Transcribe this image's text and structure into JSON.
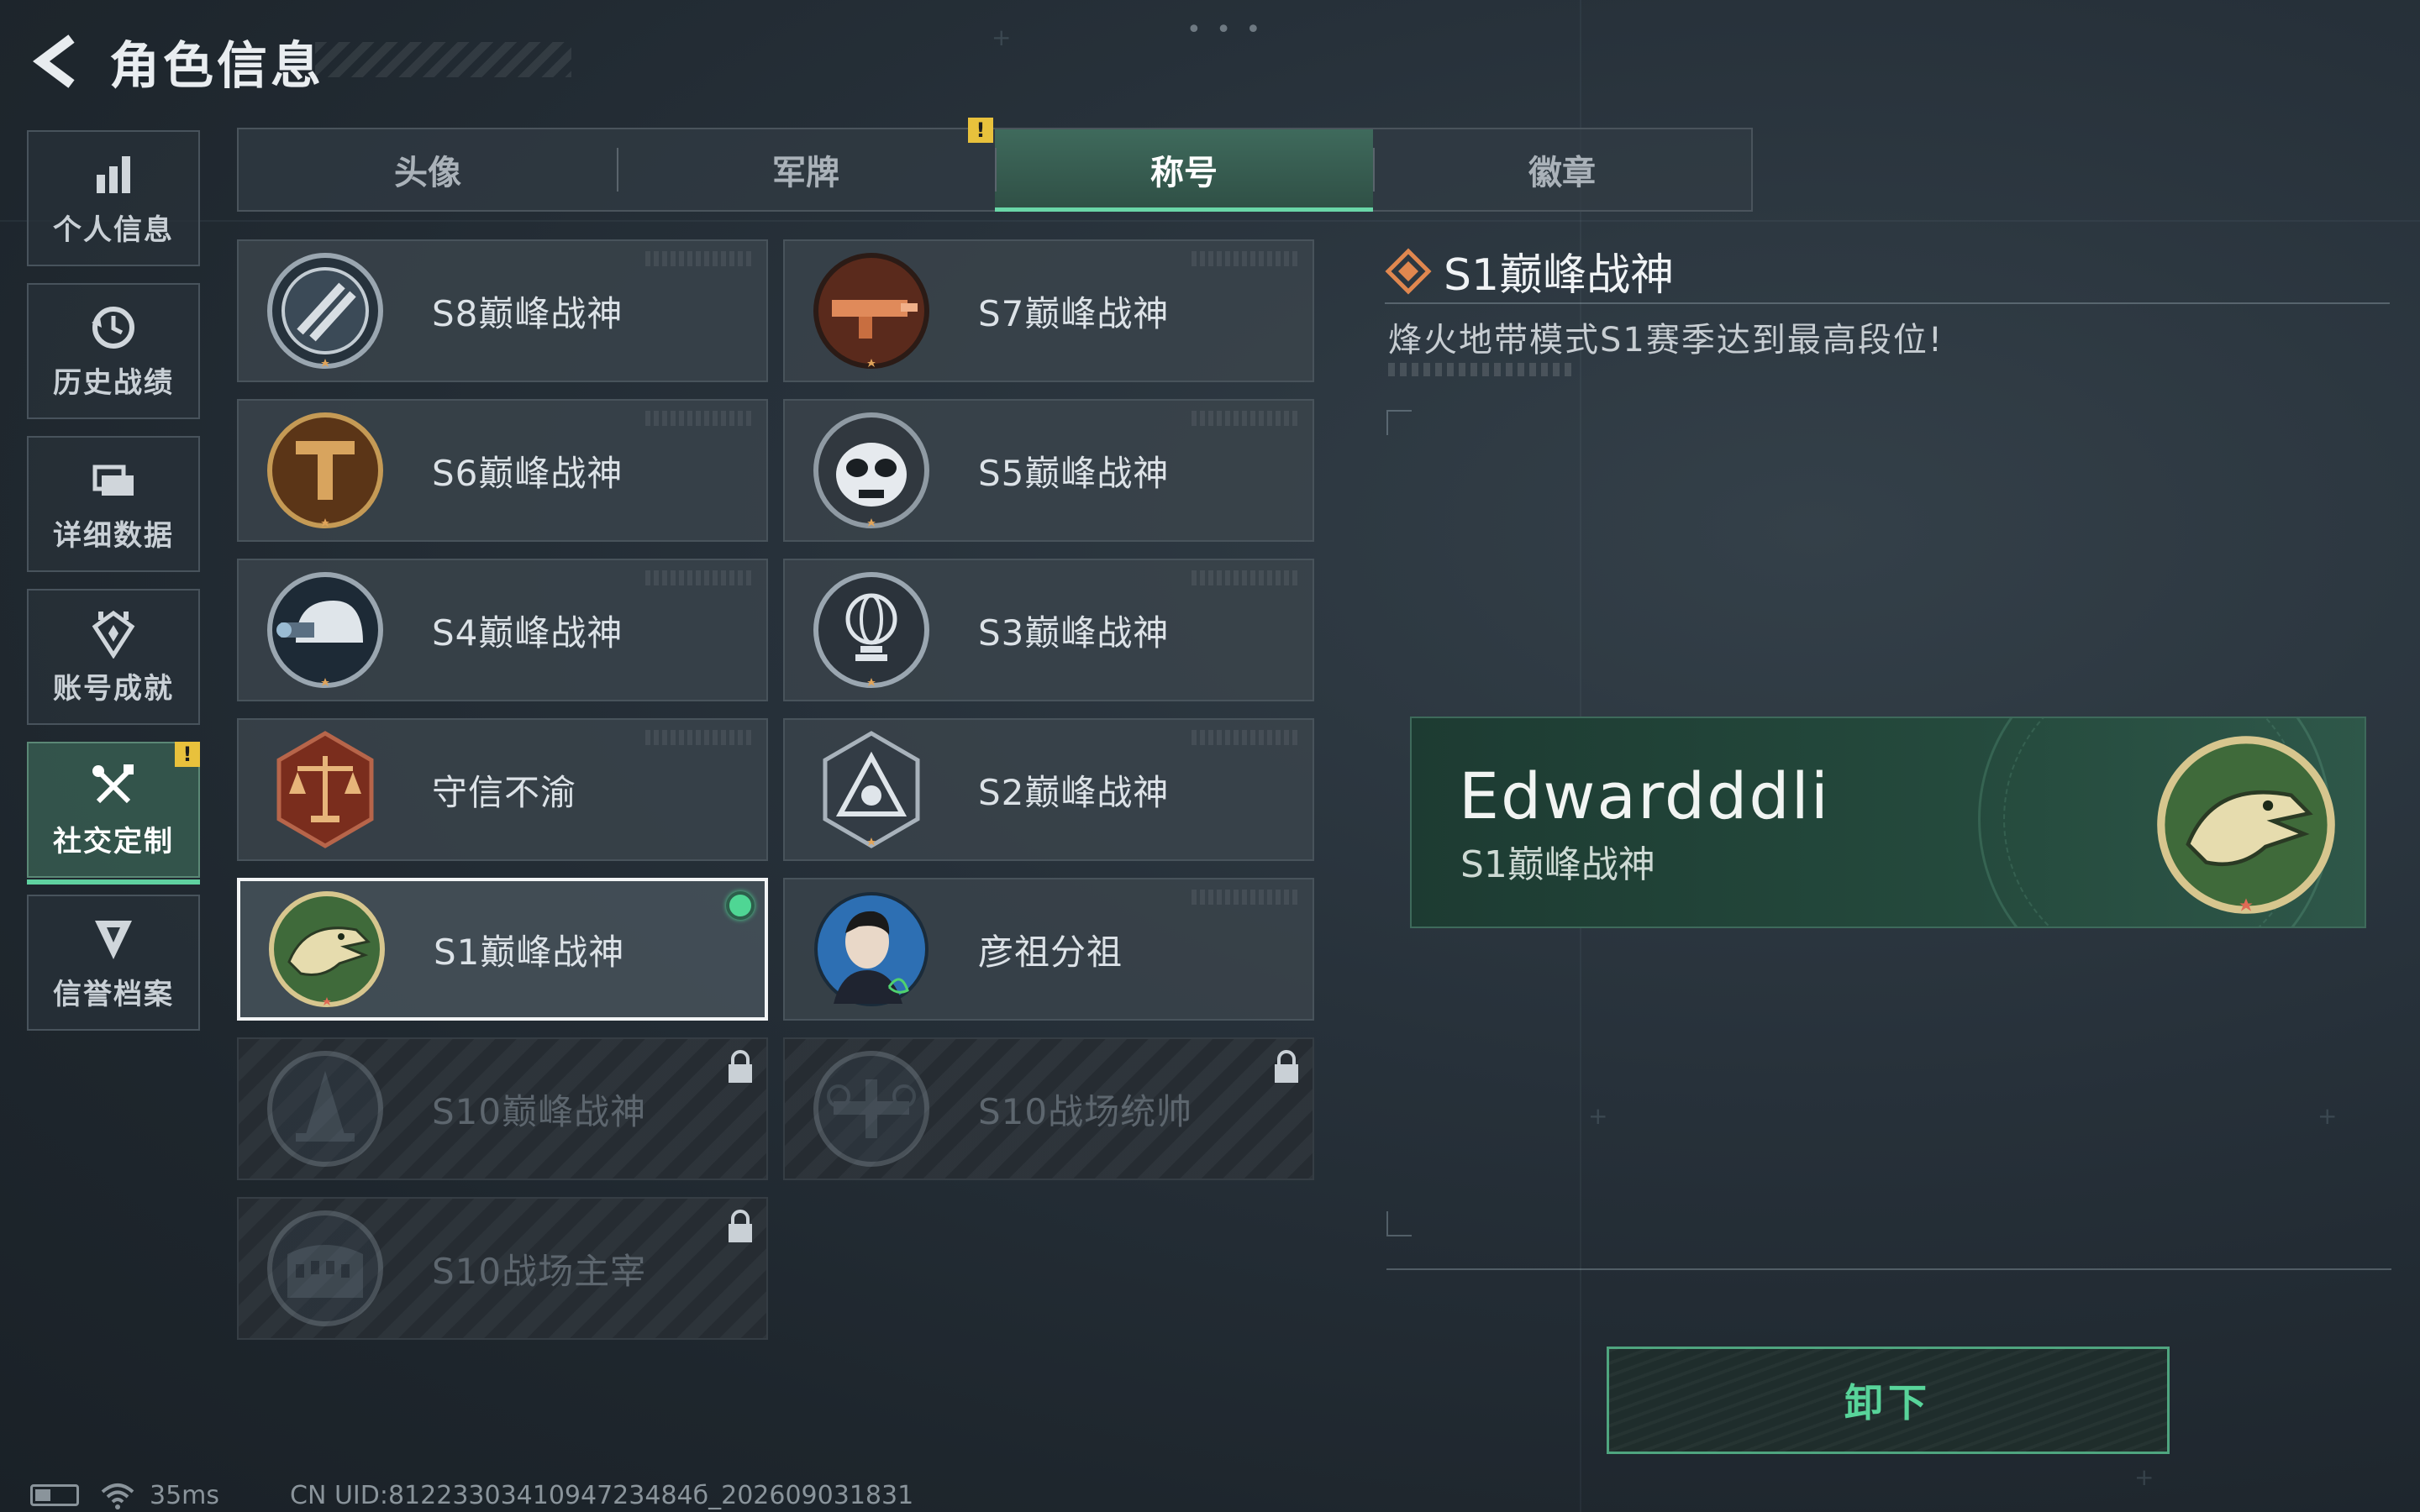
{
  "header": {
    "title": "角色信息"
  },
  "sidenav": [
    {
      "label": "个人信息",
      "icon": "bar-chart-icon"
    },
    {
      "label": "历史战绩",
      "icon": "history-clock-icon"
    },
    {
      "label": "详细数据",
      "icon": "folder-icon"
    },
    {
      "label": "账号成就",
      "icon": "achievement-icon"
    },
    {
      "label": "社交定制",
      "icon": "wrench-screwdriver-icon",
      "active": true,
      "alert": "!"
    },
    {
      "label": "信誉档案",
      "icon": "credit-shield-icon"
    }
  ],
  "tabs": [
    {
      "label": "头像"
    },
    {
      "label": "军牌",
      "alert": "!"
    },
    {
      "label": "称号",
      "active": true
    },
    {
      "label": "徽章"
    }
  ],
  "titles": [
    {
      "label": "S8巅峰战神",
      "emblem": "striped-shield-emblem"
    },
    {
      "label": "S7巅峰战神",
      "emblem": "gun-emblem"
    },
    {
      "label": "S6巅峰战神",
      "emblem": "bronze-t-emblem"
    },
    {
      "label": "S5巅峰战神",
      "emblem": "skull-mask-emblem"
    },
    {
      "label": "S4巅峰战神",
      "emblem": "night-vision-helmet-emblem"
    },
    {
      "label": "S3巅峰战神",
      "emblem": "globe-trophy-emblem"
    },
    {
      "label": "守信不渝",
      "emblem": "scales-emblem"
    },
    {
      "label": "S2巅峰战神",
      "emblem": "triangle-r-emblem"
    },
    {
      "label": "S1巅峰战神",
      "emblem": "crocodile-emblem",
      "selected": true,
      "equipped": true
    },
    {
      "label": "彦祖分祖",
      "emblem": "portrait-emblem"
    },
    {
      "label": "S10巅峰战神",
      "emblem": "tower-emblem",
      "locked": true
    },
    {
      "label": "S10战场统帅",
      "emblem": "aircraft-emblem",
      "locked": true
    },
    {
      "label": "S10战场主宰",
      "emblem": "colosseum-emblem",
      "locked": true
    }
  ],
  "detail": {
    "title": "S1巅峰战神",
    "description": "烽火地带模式S1赛季达到最高段位!"
  },
  "preview": {
    "player_name": "Edwardddli",
    "title": "S1巅峰战神"
  },
  "actions": {
    "unequip_label": "卸下"
  },
  "status": {
    "ping": "35ms",
    "uid": "CN UID:8122330341094723484б_202609031831"
  },
  "colors": {
    "accent_green": "#5fd1a0",
    "alert_yellow": "#e8c13c",
    "equipped_dot": "#4fd694"
  }
}
